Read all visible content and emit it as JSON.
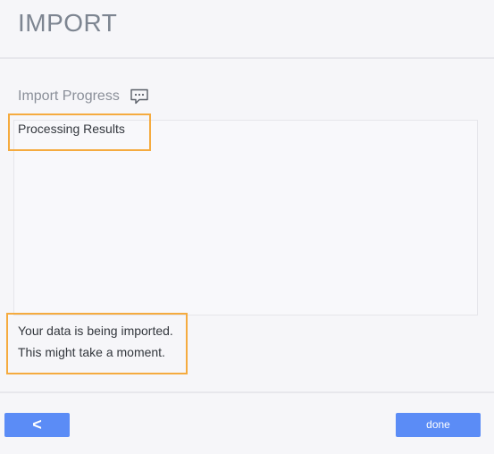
{
  "header": {
    "title": "IMPORT"
  },
  "progress_section": {
    "title": "Import Progress",
    "icon": "comment-icon",
    "results_label": "Processing Results"
  },
  "status": {
    "line1": "Your data is being imported.",
    "line2": "This might take a moment."
  },
  "footer": {
    "back_label": "<",
    "done_label": "done"
  },
  "colors": {
    "accent": "#5b8cf6",
    "highlight": "#f5ab3f",
    "background": "#f6f6f9"
  }
}
